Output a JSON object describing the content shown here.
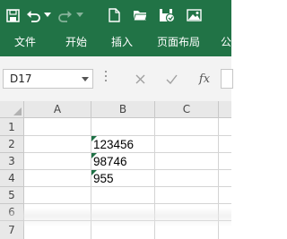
{
  "ribbon": {
    "tabs": [
      "文件",
      "开始",
      "插入",
      "页面布局",
      "公"
    ],
    "quick_access": [
      {
        "name": "save-icon"
      },
      {
        "name": "undo-icon"
      },
      {
        "name": "undo-dropdown-icon"
      },
      {
        "name": "redo-icon"
      },
      {
        "name": "redo-dropdown-icon"
      },
      {
        "name": "new-document-icon"
      },
      {
        "name": "open-folder-icon"
      },
      {
        "name": "save-to-cloud-icon"
      },
      {
        "name": "picture-icon"
      }
    ]
  },
  "formula_bar": {
    "name_box": "D17",
    "fx_label": "fx",
    "formula_value": ""
  },
  "sheet": {
    "columns": [
      "A",
      "B",
      "C"
    ],
    "rows": [
      "1",
      "2",
      "3",
      "4",
      "5",
      "6",
      "7"
    ],
    "cells": {
      "B2": "123456",
      "B3": "98746",
      "B4": "955"
    }
  },
  "colors": {
    "ribbon": "#217346",
    "header_bg": "#e8e8e8",
    "gridline": "#d4d4d4",
    "error_flag": "#1e7145"
  }
}
